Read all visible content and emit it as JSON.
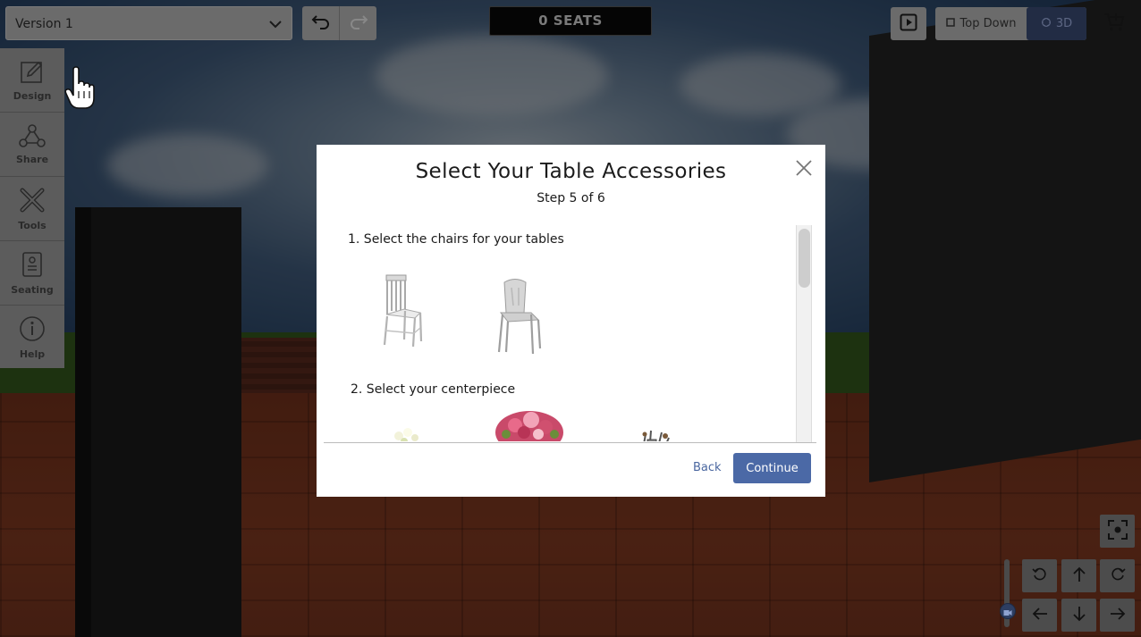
{
  "header": {
    "version_label": "Version 1",
    "seats_label": "0 SEATS",
    "view_top_down": "Top Down",
    "view_3d": "3D"
  },
  "sidebar": {
    "items": [
      {
        "label": "Design",
        "icon": "pencil-square-icon"
      },
      {
        "label": "Share",
        "icon": "share-nodes-icon"
      },
      {
        "label": "Tools",
        "icon": "tools-icon"
      },
      {
        "label": "Seating",
        "icon": "seating-chart-icon"
      },
      {
        "label": "Help",
        "icon": "info-icon"
      }
    ]
  },
  "modal": {
    "title": "Select Your Table Accessories",
    "step": "Step 5 of 6",
    "sections": [
      {
        "label": "1. Select the chairs for your tables",
        "options": [
          "chiavari-chair",
          "metal-bistro-chair"
        ]
      },
      {
        "label": "2. Select your centerpiece",
        "options": [
          "white-floral-centerpiece",
          "pink-rose-centerpiece",
          "branch-centerpiece"
        ]
      }
    ],
    "back_label": "Back",
    "continue_label": "Continue"
  },
  "colors": {
    "accent": "#4b69a6",
    "toolbar_bg": "#5c5c5c",
    "seats_bg": "#050505"
  }
}
